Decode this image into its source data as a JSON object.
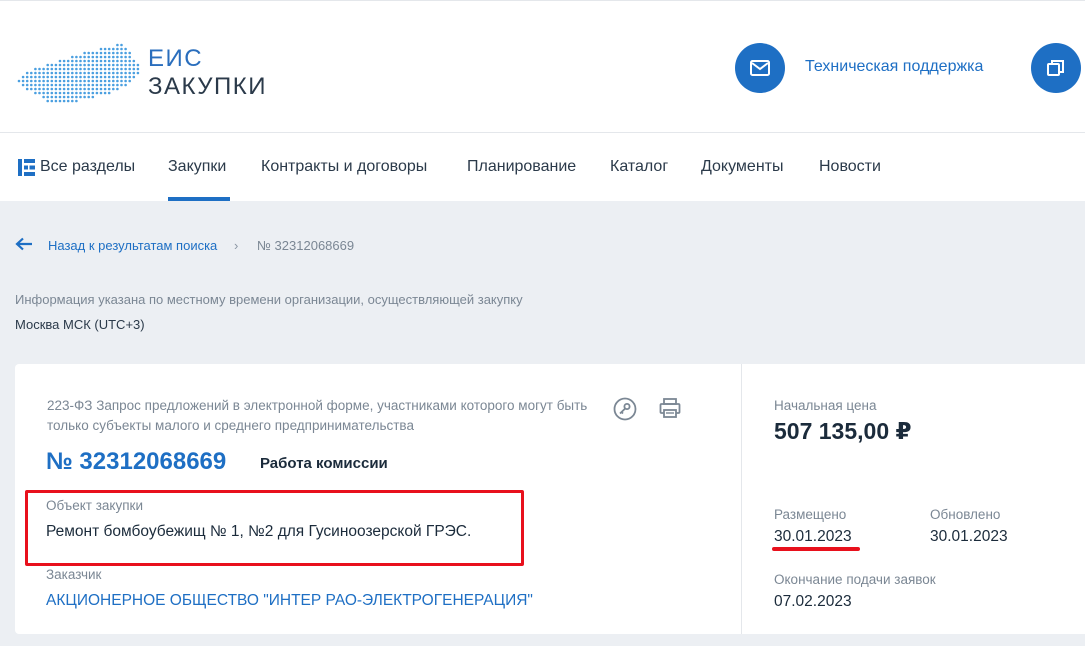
{
  "header": {
    "logo_line1": "ЕИС",
    "logo_line2": "ЗАКУПКИ",
    "support_label": "Техническая поддержка",
    "support_icon": "mail-icon",
    "windows_icon": "windows-icon"
  },
  "nav": {
    "items": [
      {
        "label": "Все разделы",
        "icon": "sections-icon"
      },
      {
        "label": "Закупки",
        "active": true
      },
      {
        "label": "Контракты и договоры"
      },
      {
        "label": "Планирование"
      },
      {
        "label": "Каталог"
      },
      {
        "label": "Документы"
      },
      {
        "label": "Новости"
      }
    ]
  },
  "breadcrumb": {
    "back_label": "Назад к результатам поиска",
    "separator": "›",
    "current": "№ 32312068669"
  },
  "timezone": {
    "note": "Информация указана по местному времени организации, осуществляющей закупку",
    "value": "Москва МСК (UTC+3)"
  },
  "procurement": {
    "type": "223-ФЗ Запрос предложений в электронной форме, участниками которого могут быть только субъекты малого и среднего предпринимательства",
    "number": "№ 32312068669",
    "status": "Работа комиссии",
    "object_label": "Объект закупки",
    "object_value": "Ремонт бомбоубежищ № 1, №2 для Гусиноозерской ГРЭС.",
    "customer_label": "Заказчик",
    "customer_value": "АКЦИОНЕРНОЕ ОБЩЕСТВО \"ИНТЕР РАО-ЭЛЕКТРОГЕНЕРАЦИЯ\""
  },
  "summary": {
    "price_label": "Начальная цена",
    "price_value": "507 135,00 ₽",
    "posted_label": "Размещено",
    "posted_value": "30.01.2023",
    "updated_label": "Обновлено",
    "updated_value": "30.01.2023",
    "deadline_label": "Окончание подачи заявок",
    "deadline_value": "07.02.2023"
  },
  "colors": {
    "accent": "#1e6fc4",
    "highlight": "#e8101c",
    "background": "#eceff3"
  }
}
